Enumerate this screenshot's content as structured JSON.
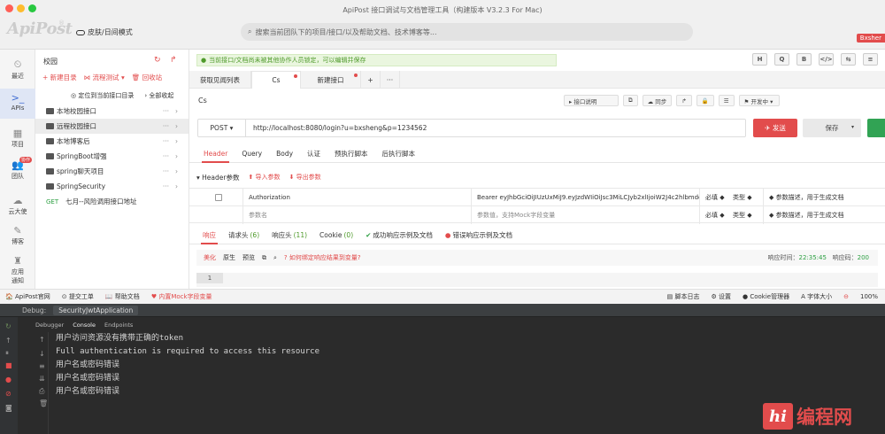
{
  "window": {
    "title": "ApiPost 接口调试与文档管理工具（构建版本 V3.2.3 For Mac)",
    "logo": "ApiPost",
    "theme_toggle": "皮肤/日间模式",
    "search_placeholder": "搜索当前团队下的项目/接口/以及帮助文档、技术博客等...",
    "user_badge": "Bxsher"
  },
  "rail": {
    "items": [
      {
        "icon": "clock-icon",
        "glyph": "⏲",
        "label": "最近"
      },
      {
        "icon": "api-icon",
        "glyph": ">_",
        "label": "APIs"
      },
      {
        "icon": "project-icon",
        "glyph": "▦",
        "label": "项目"
      },
      {
        "icon": "team-icon",
        "glyph": "👥",
        "label": "团队"
      },
      {
        "icon": "cloud-icon",
        "glyph": "☁",
        "label": "云大使"
      },
      {
        "icon": "blog-icon",
        "glyph": "✎",
        "label": "博客"
      },
      {
        "icon": "apply-icon",
        "glyph": "♜",
        "label": "应用"
      },
      {
        "icon": "notify-icon",
        "glyph": "",
        "label": "通知"
      }
    ],
    "badge": "协作"
  },
  "tree": {
    "title": "校园",
    "actions": [
      "+ 新建目录",
      "⋈ 流程测试 ▾",
      "🗑 回收站"
    ],
    "sub_actions": [
      "◎ 定位到当前接口目录",
      "› 全部收起"
    ],
    "rows": [
      {
        "type": "folder",
        "label": "本地校园接口"
      },
      {
        "type": "folder",
        "label": "远程校园接口"
      },
      {
        "type": "folder",
        "label": "本地博客后"
      },
      {
        "type": "folder",
        "label": "SpringBoot增强"
      },
      {
        "type": "folder",
        "label": "spring聊天项目"
      },
      {
        "type": "folder",
        "label": "SpringSecurity"
      },
      {
        "type": "api",
        "method": "GET",
        "label": "七月--风险调用接口地址"
      }
    ]
  },
  "notice": "当前接口/文档尚未被其他协作人员锁定，可以编辑并保存",
  "format_buttons": [
    "H",
    "Q",
    "B",
    "</>",
    "⇆",
    "≡"
  ],
  "tabs": [
    {
      "label": "获取见闻列表",
      "dot": false
    },
    {
      "label": "Cs",
      "dot": true
    },
    {
      "label": "新建接口",
      "dot": true
    },
    {
      "label": "+",
      "dot": false
    },
    {
      "label": "···",
      "dot": false
    }
  ],
  "request": {
    "name": "Cs",
    "tools": [
      "▸ 接口说明",
      "⧉",
      "☁ 同步",
      "↱",
      "🔒",
      "☰",
      "⚑ 开发中 ▾"
    ],
    "method": "POST ▾",
    "url": "http://localhost:8080/login?u=bxsheng&p=1234562",
    "send_label": "✈ 发送",
    "save_label": "保存",
    "sub_tabs": [
      "Header",
      "Query",
      "Body",
      "认证",
      "预执行脚本",
      "后执行脚本"
    ],
    "header_label": "▾ Header参数",
    "import_label": "⬆ 导入参数",
    "export_label": "⬇ 导出参数",
    "params": [
      {
        "name": "Authorization",
        "value": "Bearer eyJhbGciOiJIUzUxMiJ9.eyJzdWIiOiJsc3MiLCJyb2xlIjoiW2J4c2hlbmdd",
        "required": "必填 ◆",
        "type": "类型 ◆",
        "desc": "◆ 参数描述，用于生成文档",
        "placeholder": false
      },
      {
        "name": "参数名",
        "value": "参数值，支持Mock字段变量",
        "required": "必填 ◆",
        "type": "类型 ◆",
        "desc": "◆ 参数描述，用于生成文档",
        "placeholder": true
      }
    ]
  },
  "response": {
    "tabs": [
      {
        "label": "响应",
        "count": ""
      },
      {
        "label": "请求头",
        "count": "(6)"
      },
      {
        "label": "响应头",
        "count": "(11)"
      },
      {
        "label": "Cookie",
        "count": "(0)"
      },
      {
        "label": "成功响应示例及文档",
        "count": "",
        "icon": "ok"
      },
      {
        "label": "错误响应示例及文档",
        "count": "",
        "icon": "err"
      }
    ],
    "views": [
      "美化",
      "原生",
      "预览"
    ],
    "bind_link": "如何绑定响应结果到变量?",
    "time_label": "响应时间：",
    "time_value": "22:35:45",
    "code_label": "响应码：",
    "code_value": "200",
    "line_no": "1"
  },
  "statusbar": {
    "left": [
      "🏠 ApiPost官网",
      "⊙ 提交工单",
      "📖 帮助文档",
      "♥ 内置Mock字段变量"
    ],
    "right": [
      "▤ 脚本日志",
      "⚙ 设置",
      "● Cookie管理器",
      "A 字体大小",
      "⊖",
      "100%"
    ]
  },
  "ide": {
    "debug_label": "Debug:",
    "app_name": "SecurityJwtApplication",
    "tabs": [
      "Debugger",
      "Console",
      "Endpoints"
    ],
    "console_lines": [
      "用户访问资源没有携带正确的token",
      "Full authentication is required to access this resource",
      "用户名或密码错误",
      "用户名或密码错误",
      "用户名或密码错误"
    ]
  },
  "watermark": {
    "logo": "hi",
    "text": "编程网"
  },
  "colors": {
    "accent": "#e24c4c",
    "success": "#2ea043",
    "notice_bg": "#eaf6df",
    "ide_bg": "#2b2b2b"
  }
}
